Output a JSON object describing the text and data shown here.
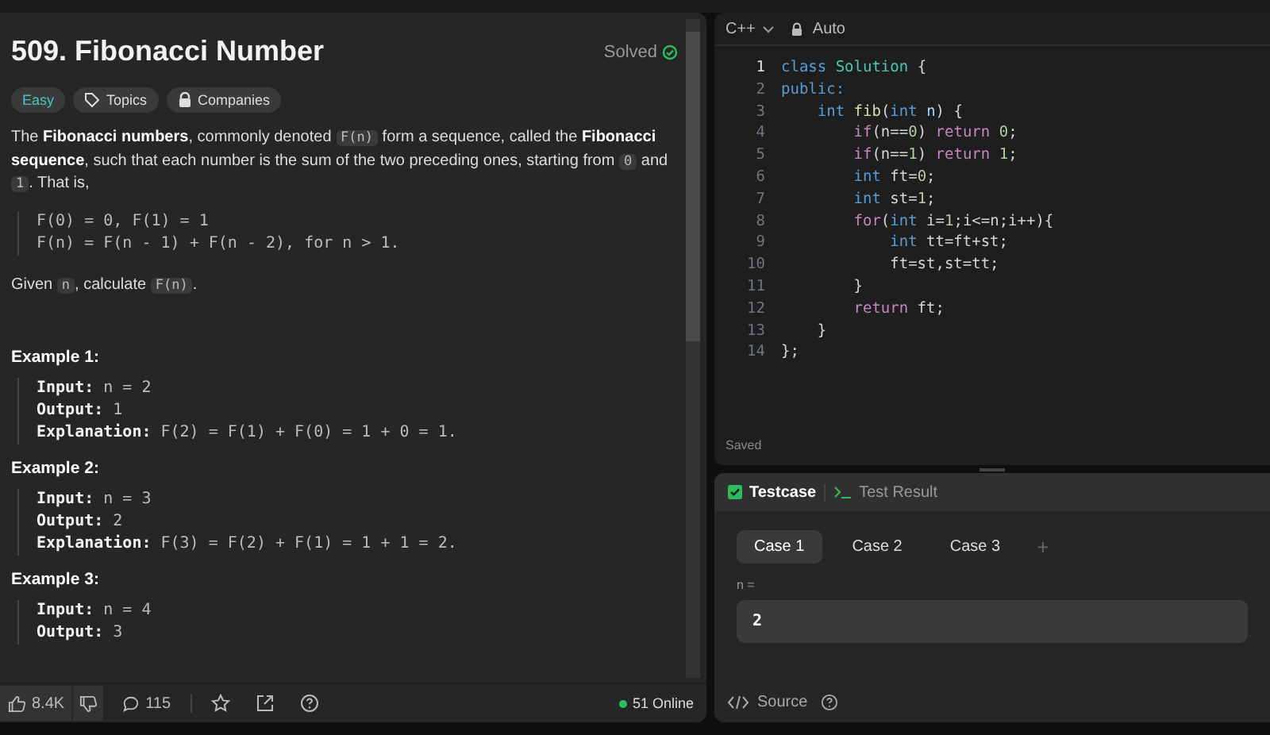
{
  "problem": {
    "title": "509. Fibonacci Number",
    "status": "Solved",
    "solved": true,
    "tags": [
      {
        "kind": "difficulty",
        "label": "Easy"
      },
      {
        "kind": "topics",
        "label": "Topics"
      },
      {
        "kind": "companies",
        "label": "Companies"
      }
    ],
    "description": [
      [
        {
          "kind": "text",
          "text": "The **Fibonacci numbers**, commonly denoted "
        },
        {
          "kind": "code",
          "text": "F(n)"
        },
        {
          "kind": "text",
          "text": " form a sequence, called the **Fibonacci sequence**, such that each number is the sum of the two preceding ones, starting from "
        },
        {
          "kind": "code",
          "text": "0"
        },
        {
          "kind": "text",
          "text": " and "
        },
        {
          "kind": "code",
          "text": "1"
        },
        {
          "kind": "text",
          "text": ". That is,"
        }
      ]
    ],
    "formula": [
      "F(0) = 0, F(1) = 1",
      "F(n) = F(n - 1) + F(n - 2), for n > 1."
    ],
    "task": [
      {
        "kind": "text",
        "text": "Given "
      },
      {
        "kind": "code",
        "text": "n"
      },
      {
        "kind": "text",
        "text": ", calculate "
      },
      {
        "kind": "code",
        "text": "F(n)"
      },
      {
        "kind": "text",
        "text": "."
      }
    ],
    "examples": [
      {
        "heading": "Example 1:",
        "lines": [
          {
            "label": "Input:",
            "value": "n = 2"
          },
          {
            "label": "Output:",
            "value": "1"
          },
          {
            "label": "Explanation:",
            "value": "F(2) = F(1) + F(0) = 1 + 0 = 1."
          }
        ]
      },
      {
        "heading": "Example 2:",
        "lines": [
          {
            "label": "Input:",
            "value": "n = 3"
          },
          {
            "label": "Output:",
            "value": "2"
          },
          {
            "label": "Explanation:",
            "value": "F(3) = F(2) + F(1) = 1 + 1 = 2."
          }
        ]
      },
      {
        "heading": "Example 3:",
        "lines": [
          {
            "label": "Input:",
            "value": "n = 4"
          },
          {
            "label": "Output:",
            "value": "3"
          }
        ]
      }
    ]
  },
  "footer": {
    "likes": "8.4K",
    "comments": "115",
    "online": "51 Online"
  },
  "editor": {
    "language": "C++",
    "mode": "Auto",
    "status": "Saved",
    "lines": [
      {
        "number": "1",
        "active": true,
        "tokens": [
          {
            "kind": "keyword",
            "text": "class"
          },
          {
            "kind": "class",
            "text": " Solution"
          },
          {
            "kind": "plain",
            "text": " {"
          }
        ]
      },
      {
        "number": "2",
        "active": false,
        "tokens": [
          {
            "kind": "keyword",
            "text": "public:"
          }
        ]
      },
      {
        "number": "3",
        "active": false,
        "tokens": [
          {
            "kind": "keyword",
            "text": "    int"
          },
          {
            "kind": "func",
            "text": " fib"
          },
          {
            "kind": "plain",
            "text": "("
          },
          {
            "kind": "keyword",
            "text": "int"
          },
          {
            "kind": "var",
            "text": " n"
          },
          {
            "kind": "plain",
            "text": ") {"
          }
        ]
      },
      {
        "number": "4",
        "active": false,
        "tokens": [
          {
            "kind": "control",
            "text": "        if"
          },
          {
            "kind": "plain",
            "text": "(n=="
          },
          {
            "kind": "num",
            "text": "0"
          },
          {
            "kind": "plain",
            "text": ") "
          },
          {
            "kind": "control",
            "text": "return"
          },
          {
            "kind": "num",
            "text": " 0"
          },
          {
            "kind": "plain",
            "text": ";"
          }
        ]
      },
      {
        "number": "5",
        "active": false,
        "tokens": [
          {
            "kind": "control",
            "text": "        if"
          },
          {
            "kind": "plain",
            "text": "(n=="
          },
          {
            "kind": "num",
            "text": "1"
          },
          {
            "kind": "plain",
            "text": ") "
          },
          {
            "kind": "control",
            "text": "return"
          },
          {
            "kind": "num",
            "text": " 1"
          },
          {
            "kind": "plain",
            "text": ";"
          }
        ]
      },
      {
        "number": "6",
        "active": false,
        "tokens": [
          {
            "kind": "keyword",
            "text": "        int"
          },
          {
            "kind": "plain",
            "text": " ft="
          },
          {
            "kind": "num",
            "text": "0"
          },
          {
            "kind": "plain",
            "text": ";"
          }
        ]
      },
      {
        "number": "7",
        "active": false,
        "tokens": [
          {
            "kind": "keyword",
            "text": "        int"
          },
          {
            "kind": "plain",
            "text": " st="
          },
          {
            "kind": "num",
            "text": "1"
          },
          {
            "kind": "plain",
            "text": ";"
          }
        ]
      },
      {
        "number": "8",
        "active": false,
        "tokens": [
          {
            "kind": "control",
            "text": "        for"
          },
          {
            "kind": "plain",
            "text": "("
          },
          {
            "kind": "keyword",
            "text": "int"
          },
          {
            "kind": "plain",
            "text": " i="
          },
          {
            "kind": "num",
            "text": "1"
          },
          {
            "kind": "plain",
            "text": ";i<=n;i++){"
          }
        ]
      },
      {
        "number": "9",
        "active": false,
        "tokens": [
          {
            "kind": "keyword",
            "text": "            int"
          },
          {
            "kind": "plain",
            "text": " tt=ft+st;"
          }
        ]
      },
      {
        "number": "10",
        "active": false,
        "tokens": [
          {
            "kind": "plain",
            "text": "            ft=st,st=tt;"
          }
        ]
      },
      {
        "number": "11",
        "active": false,
        "tokens": [
          {
            "kind": "plain",
            "text": "        }"
          }
        ]
      },
      {
        "number": "12",
        "active": false,
        "tokens": [
          {
            "kind": "control",
            "text": "        return"
          },
          {
            "kind": "plain",
            "text": " ft;"
          }
        ]
      },
      {
        "number": "13",
        "active": false,
        "tokens": [
          {
            "kind": "plain",
            "text": "    }"
          }
        ]
      },
      {
        "number": "14",
        "active": false,
        "tokens": [
          {
            "kind": "plain",
            "text": "};"
          }
        ]
      }
    ]
  },
  "console": {
    "tabs": [
      {
        "kind": "testcase",
        "label": "Testcase",
        "selected": true
      },
      {
        "kind": "result",
        "label": "Test Result",
        "selected": false
      }
    ],
    "cases": [
      {
        "label": "Case 1",
        "selected": true
      },
      {
        "label": "Case 2",
        "selected": false
      },
      {
        "label": "Case 3",
        "selected": false
      }
    ],
    "add": "+",
    "param_label": "n =",
    "param_value": "2",
    "source": "Source"
  }
}
